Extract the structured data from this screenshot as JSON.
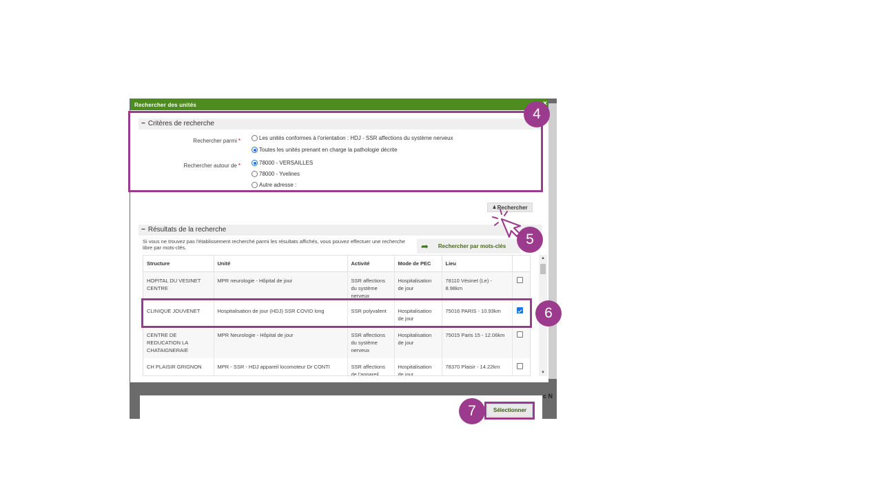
{
  "dialog": {
    "title": "Rechercher des unités",
    "close_glyph": "×"
  },
  "criteria": {
    "header": "Critères de recherche",
    "search_among_label": "Rechercher parmi",
    "required_mark": "*",
    "search_among_options": [
      {
        "label": "Les unités conformes à l'orientation : HDJ - SSR affections du système nerveux",
        "checked": false
      },
      {
        "label": "Toutes les unités prenant en charge la pathologie décrite",
        "checked": true
      }
    ],
    "search_around_label": "Rechercher autour de",
    "search_around_options": [
      {
        "label": "78000 - VERSAILLES",
        "checked": true
      },
      {
        "label": "78000 - Yvelines",
        "checked": false
      },
      {
        "label": "Autre adresse :",
        "checked": false
      }
    ]
  },
  "search_button": {
    "label": "Rechercher",
    "icon": "user-plus-icon"
  },
  "results": {
    "header": "Résultats de la recherche",
    "info_text": "Si vous ne trouvez pas l'établissement recherché parmi les résultats affichés, vous pouvez effectuer une recherche libre par mots-clés.",
    "keywords_button": "Rechercher par mots-clés",
    "columns": [
      "Structure",
      "Unité",
      "Activité",
      "Mode de PEC",
      "Lieu",
      ""
    ],
    "rows": [
      {
        "structure": "HOPITAL DU VESINET CENTRE",
        "unite": "MPR neurologie - Hôpital de jour",
        "activite": "SSR affections du système nerveux",
        "mode": "Hospitalisation de jour",
        "lieu": "78110 Vésinet (Le) - 8.98km",
        "checked": false
      },
      {
        "structure": "CLINIQUE JOUVENET",
        "unite": "Hospitalisation de jour (HDJ) SSR COVID long",
        "activite": "SSR polyvalent",
        "mode": "Hospitalisation de jour",
        "lieu": "75016 PARIS - 10.93km",
        "checked": true
      },
      {
        "structure": "CENTRE DE REDUCATION LA CHATAIGNERAIE",
        "unite": "MPR Neurologie - Hôpital de jour",
        "activite": "SSR affections du système nerveux",
        "mode": "Hospitalisation de jour",
        "lieu": "75015 Paris 15 - 12.06km",
        "checked": false
      },
      {
        "structure": "CH PLAISIR GRIGNON",
        "unite": "MPR - SSR - HDJ appareil locomoteur Dr CONTI",
        "activite": "SSR affections de l'appareil locomoteur",
        "mode": "Hospitalisation de jour",
        "lieu": "78370 Plaisir - 14.22km",
        "checked": false
      }
    ]
  },
  "select_button": "Sélectionner",
  "backdrop_hint": "c N",
  "annotations": {
    "step4": "4",
    "step5": "5",
    "step6": "6",
    "step7": "7",
    "color": "#9c3a8e"
  },
  "colors": {
    "titlebar": "#4e8c1f",
    "checkbox_checked": "#1a73e8"
  }
}
